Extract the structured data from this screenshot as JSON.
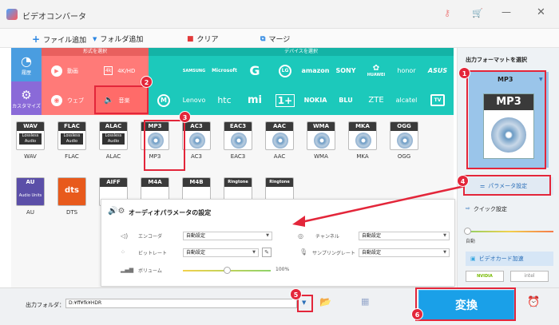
{
  "title": "ビデオコンバータ",
  "toolbar": {
    "add_file": "ファイル追加",
    "add_folder": "フォルダ追加",
    "clear": "クリア",
    "merge": "マージ"
  },
  "categories": {
    "format": "形式を選択",
    "device": "デバイスを選択"
  },
  "side": {
    "history": "履歴",
    "custom": "カスタマイズ"
  },
  "format_tiles": {
    "video": "動画",
    "hd": "4K/HD",
    "web": "ウェブ",
    "music": "音楽"
  },
  "devices_row1": [
    "",
    "SAMSUNG",
    "Microsoft",
    "G",
    "LG",
    "amazon",
    "SONY",
    "HUAWEI",
    "honor",
    "ASUS"
  ],
  "devices_row2": [
    "",
    "Lenovo",
    "htc",
    "mi",
    "1+",
    "NOKIA",
    "BLU",
    "ZTE",
    "alcatel",
    "TV"
  ],
  "formats_row1": [
    "WAV",
    "FLAC",
    "ALAC",
    "MP3",
    "AC3",
    "EAC3",
    "AAC",
    "WMA",
    "MKA",
    "OGG"
  ],
  "formats_row2": [
    "AU",
    "DTS"
  ],
  "formats_row2_partial": [
    "AIFF",
    "M4A",
    "M4B",
    "Ringtone",
    "Ringtone"
  ],
  "box_labels": {
    "lossless": "Lossless",
    "audio": "Audio",
    "au_sub": "Audio Units",
    "dts": "dts"
  },
  "audio_panel": {
    "title": "オーディオパラメータの設定",
    "encoder_label": "エンコーダ",
    "encoder_value": "自動設定",
    "bitrate_label": "ビットレート",
    "bitrate_value": "自動設定",
    "volume_label": "ボリューム",
    "volume_pct": "100%",
    "volume_level": 0.5,
    "channel_label": "チャンネル",
    "channel_value": "自動設定",
    "samplerate_label": "サンプリングレート",
    "samplerate_value": "自動設定"
  },
  "right_panel": {
    "heading": "出力フォーマットを選択",
    "selected_format": "MP3",
    "param_settings": "パラメータ設定",
    "quick_settings": "クイック設定",
    "auto": "自動",
    "gpu": "ビデオカード加速",
    "nvidia": "NVIDIA",
    "intel": "intel"
  },
  "bottom": {
    "output_folder_label": "出力フォルダ：",
    "output_folder_value": "D:¥ff¥fk¥HDR",
    "convert": "変換"
  },
  "badges": [
    "1",
    "2",
    "3",
    "4",
    "5",
    "6"
  ],
  "colors": {
    "coral": "#ff7a78",
    "teal": "#1cc9bb",
    "blue": "#3a8ee6",
    "convert": "#1aa0e8",
    "annotation_red": "#e3263a"
  }
}
